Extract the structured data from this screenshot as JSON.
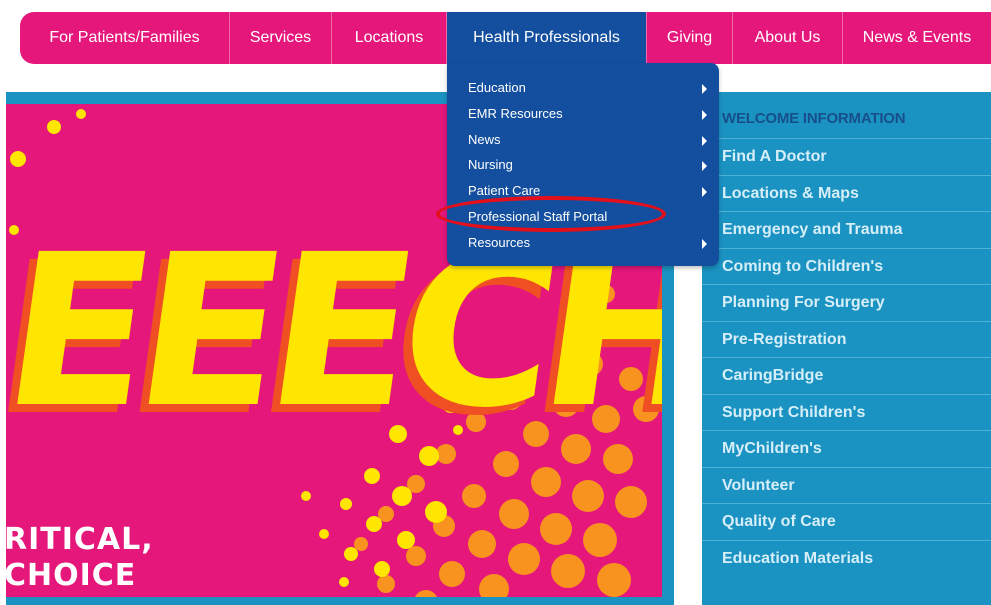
{
  "topnav": {
    "items": [
      {
        "label": "For Patients/Families"
      },
      {
        "label": "Services"
      },
      {
        "label": "Locations"
      },
      {
        "label": "Health Professionals"
      },
      {
        "label": "Giving"
      },
      {
        "label": "About Us"
      },
      {
        "label": "News & Events"
      }
    ],
    "active": "Health Professionals"
  },
  "dropdown": {
    "items": [
      {
        "label": "Education",
        "submenu": true
      },
      {
        "label": "EMR Resources",
        "submenu": true
      },
      {
        "label": "News",
        "submenu": true
      },
      {
        "label": "Nursing",
        "submenu": true
      },
      {
        "label": "Patient Care",
        "submenu": true
      },
      {
        "label": "Professional Staff Portal",
        "submenu": false
      },
      {
        "label": "Resources",
        "submenu": true
      }
    ],
    "highlighted": "Professional Staff Portal"
  },
  "hero": {
    "headline": "EEECH!",
    "caption_line1": "RITICAL,",
    "caption_line2": "CHOICE"
  },
  "sidebar": {
    "heading": "WELCOME INFORMATION",
    "items": [
      {
        "label": "Find A Doctor"
      },
      {
        "label": "Locations & Maps"
      },
      {
        "label": "Emergency and Trauma"
      },
      {
        "label": "Coming to Children's"
      },
      {
        "label": "Planning For Surgery"
      },
      {
        "label": "Pre-Registration"
      },
      {
        "label": "CaringBridge"
      },
      {
        "label": "Support Children's"
      },
      {
        "label": "MyChildren's"
      },
      {
        "label": "Volunteer"
      },
      {
        "label": "Quality of Care"
      },
      {
        "label": "Education Materials"
      }
    ]
  },
  "colors": {
    "nav_pink": "#e5177b",
    "nav_active_blue": "#134f9e",
    "sidebar_blue": "#1a93c2",
    "comic_yellow": "#ffe600",
    "comic_orange": "#f7931e",
    "highlight_red": "#e3101c"
  }
}
